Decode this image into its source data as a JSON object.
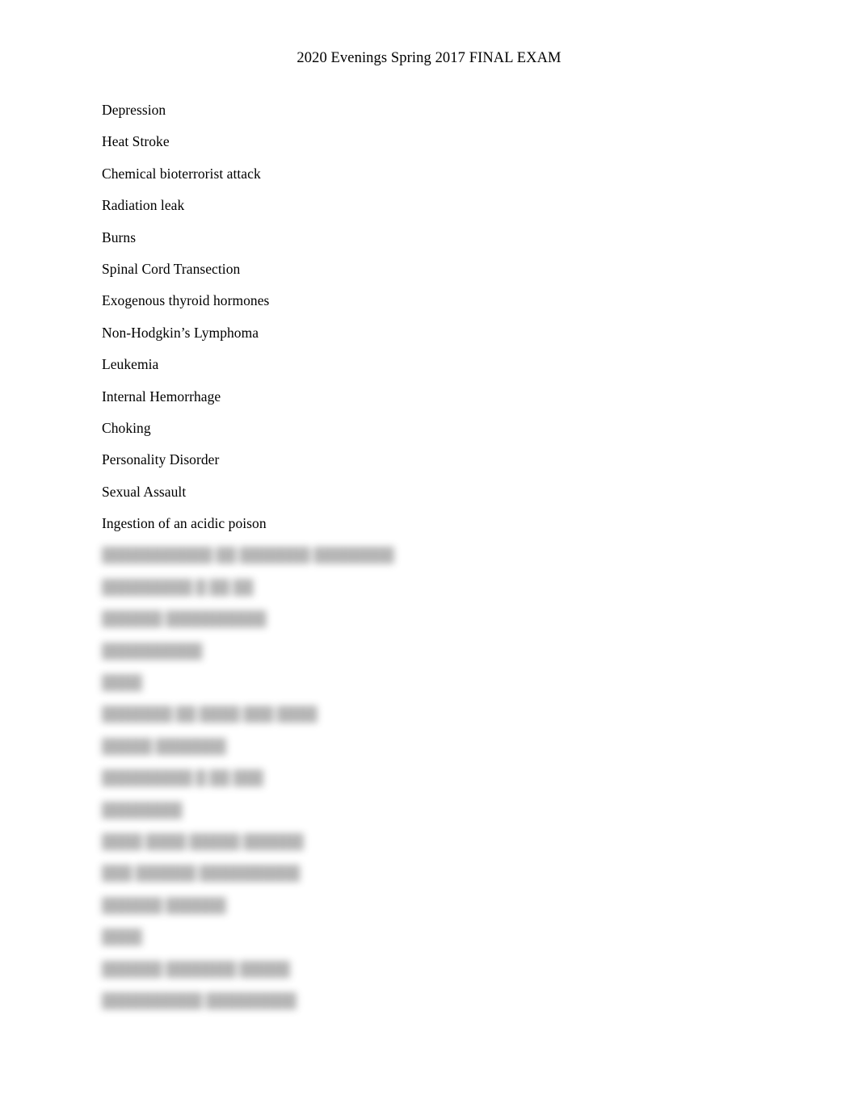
{
  "document": {
    "title": "2020 Evenings Spring 2017 FINAL EXAM",
    "page_background": "#ffffff",
    "text_color": "#000000"
  },
  "list": {
    "items": [
      {
        "label": "Depression",
        "redacted": false
      },
      {
        "label": "Heat Stroke",
        "redacted": false
      },
      {
        "label": "Chemical bioterrorist attack",
        "redacted": false
      },
      {
        "label": "Radiation leak",
        "redacted": false
      },
      {
        "label": "Burns",
        "redacted": false
      },
      {
        "label": "Spinal Cord Transection",
        "redacted": false
      },
      {
        "label": "Exogenous thyroid hormones",
        "redacted": false
      },
      {
        "label": "Non-Hodgkin’s Lymphoma",
        "redacted": false
      },
      {
        "label": "Leukemia",
        "redacted": false
      },
      {
        "label": "Internal Hemorrhage",
        "redacted": false
      },
      {
        "label": "Choking",
        "redacted": false
      },
      {
        "label": "Personality Disorder",
        "redacted": false
      },
      {
        "label": "Sexual Assault",
        "redacted": false
      },
      {
        "label": "Ingestion of an acidic poison",
        "redacted": false
      },
      {
        "label": "███████████ ██ ███████ ████████",
        "redacted": true
      },
      {
        "label": "█████████ █ ██ ██",
        "redacted": true
      },
      {
        "label": "██████ ██████████",
        "redacted": true
      },
      {
        "label": "██████████",
        "redacted": true
      },
      {
        "label": "████",
        "redacted": true
      },
      {
        "label": "███████ ██ ████ ███ ████",
        "redacted": true
      },
      {
        "label": "█████ ███████",
        "redacted": true
      },
      {
        "label": "█████████ █ ██ ███",
        "redacted": true
      },
      {
        "label": "████████",
        "redacted": true
      },
      {
        "label": "████ ████ █████ ██████",
        "redacted": true
      },
      {
        "label": "███ ██████ ██████████",
        "redacted": true
      },
      {
        "label": "██████ ██████",
        "redacted": true
      },
      {
        "label": "████",
        "redacted": true
      },
      {
        "label": "██████ ███████ █████",
        "redacted": true
      },
      {
        "label": "██████████ █████████",
        "redacted": true
      }
    ]
  }
}
